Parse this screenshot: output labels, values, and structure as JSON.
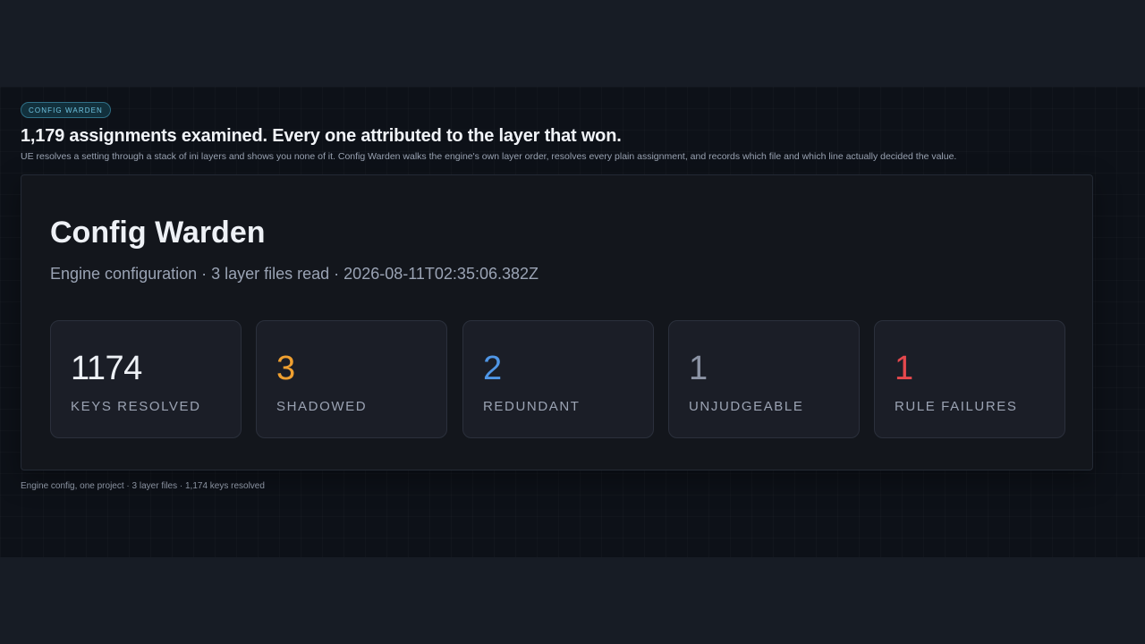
{
  "badge": "CONFIG WARDEN",
  "headline": "1,179 assignments examined. Every one attributed to the layer that won.",
  "lede": "UE resolves a setting through a stack of ini layers and shows you none of it. Config Warden walks the engine's own layer order, resolves every plain assignment, and records which file and which line actually decided the value.",
  "card": {
    "title": "Config Warden",
    "subtitle": "Engine configuration · 3 layer files read · 2026-08-11T02:35:06.382Z"
  },
  "stats": [
    {
      "value": "1174",
      "label": "KEYS RESOLVED",
      "color": "#eef1f6"
    },
    {
      "value": "3",
      "label": "SHADOWED",
      "color": "#f0a030"
    },
    {
      "value": "2",
      "label": "REDUNDANT",
      "color": "#4f96e6"
    },
    {
      "value": "1",
      "label": "UNJUDGEABLE",
      "color": "#8c94a5"
    },
    {
      "value": "1",
      "label": "RULE FAILURES",
      "color": "#e5484d"
    }
  ],
  "footnote": "Engine config, one project · 3 layer files · 1,174 keys resolved"
}
